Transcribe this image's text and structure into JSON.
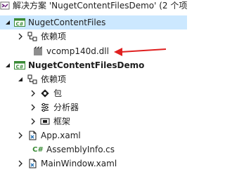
{
  "solution": {
    "label": "解决方案 'NugetContentFilesDemo' (2 个项"
  },
  "project1": {
    "name": "NugetContentFiles",
    "dependencies": "依赖项",
    "file": "vcomp140d.dll"
  },
  "project2": {
    "name": "NugetContentFilesDemo",
    "dependencies": "依赖项",
    "dep_items": [
      "包",
      "分析器",
      "框架"
    ],
    "files": [
      "App.xaml",
      "AssemblyInfo.cs",
      "MainWindow.xaml"
    ]
  },
  "icons": {
    "project_badge": "C#",
    "cs_file": "C#"
  },
  "colors": {
    "selection": "#cce8ff",
    "annotation_arrow": "#e02020",
    "csharp_green": "#388a34"
  }
}
